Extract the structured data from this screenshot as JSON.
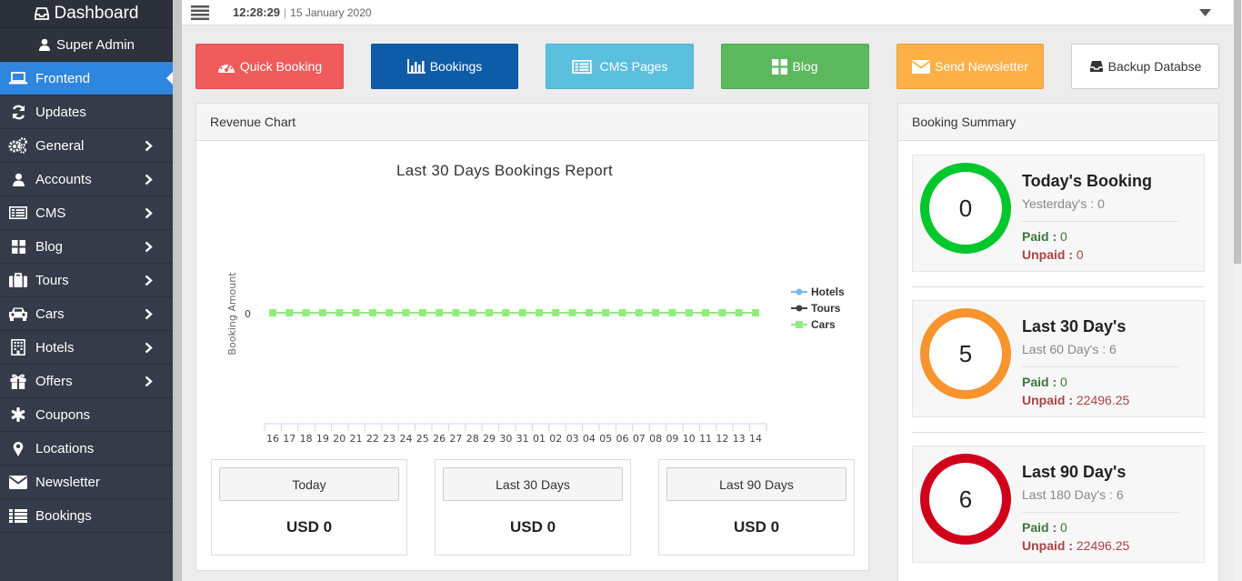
{
  "sidebar": {
    "brand": "Dashboard",
    "user": "Super Admin",
    "items": [
      {
        "label": "Frontend",
        "icon": "laptop-icon",
        "active": true
      },
      {
        "label": "Updates",
        "icon": "refresh-icon"
      },
      {
        "label": "General",
        "icon": "gears-icon",
        "submenu": true
      },
      {
        "label": "Accounts",
        "icon": "user-icon",
        "submenu": true
      },
      {
        "label": "CMS",
        "icon": "list-icon",
        "submenu": true
      },
      {
        "label": "Blog",
        "icon": "grid-icon",
        "submenu": true
      },
      {
        "label": "Tours",
        "icon": "suitcase-icon",
        "submenu": true
      },
      {
        "label": "Cars",
        "icon": "car-icon",
        "submenu": true
      },
      {
        "label": "Hotels",
        "icon": "building-icon",
        "submenu": true
      },
      {
        "label": "Offers",
        "icon": "gift-icon",
        "submenu": true
      },
      {
        "label": "Coupons",
        "icon": "asterisk-icon"
      },
      {
        "label": "Locations",
        "icon": "map-marker-icon"
      },
      {
        "label": "Newsletter",
        "icon": "envelope-icon"
      },
      {
        "label": "Bookings",
        "icon": "list-icon"
      }
    ]
  },
  "topbar": {
    "time": "12:28:29",
    "separator": "|",
    "date": "15 January 2020"
  },
  "quick_buttons": {
    "quick_booking": "Quick Booking",
    "bookings": "Bookings",
    "cms_pages": "CMS Pages",
    "blog": "Blog",
    "send_newsletter": "Send Newsletter",
    "backup": "Backup Databse"
  },
  "colors": {
    "quick_booking": "#ef5b5b",
    "bookings": "#0e5ca8",
    "cms_pages": "#5bc0de",
    "blog": "#5cb85c",
    "send_newsletter": "#fdb046",
    "sidebar_active": "#2e86de"
  },
  "revenue": {
    "title": "Revenue Chart",
    "stats": [
      {
        "label": "Today",
        "value": "USD 0"
      },
      {
        "label": "Last 30 Days",
        "value": "USD 0"
      },
      {
        "label": "Last 90 Days",
        "value": "USD 0"
      }
    ]
  },
  "chart_data": {
    "type": "line",
    "title": "Last 30 Days Bookings Report",
    "xlabel": "",
    "ylabel": "Booking Amount",
    "categories": [
      "16",
      "17",
      "18",
      "19",
      "20",
      "21",
      "22",
      "23",
      "24",
      "25",
      "26",
      "27",
      "28",
      "29",
      "30",
      "31",
      "01",
      "02",
      "03",
      "04",
      "05",
      "06",
      "07",
      "08",
      "09",
      "10",
      "11",
      "12",
      "13",
      "14"
    ],
    "y_ticks": [
      "0"
    ],
    "legend_position": "right",
    "series": [
      {
        "name": "Hotels",
        "color": "#7cb5ec",
        "values": [
          0,
          0,
          0,
          0,
          0,
          0,
          0,
          0,
          0,
          0,
          0,
          0,
          0,
          0,
          0,
          0,
          0,
          0,
          0,
          0,
          0,
          0,
          0,
          0,
          0,
          0,
          0,
          0,
          0,
          0
        ]
      },
      {
        "name": "Tours",
        "color": "#434348",
        "values": [
          0,
          0,
          0,
          0,
          0,
          0,
          0,
          0,
          0,
          0,
          0,
          0,
          0,
          0,
          0,
          0,
          0,
          0,
          0,
          0,
          0,
          0,
          0,
          0,
          0,
          0,
          0,
          0,
          0,
          0
        ]
      },
      {
        "name": "Cars",
        "color": "#90ed7d",
        "values": [
          0,
          0,
          0,
          0,
          0,
          0,
          0,
          0,
          0,
          0,
          0,
          0,
          0,
          0,
          0,
          0,
          0,
          0,
          0,
          0,
          0,
          0,
          0,
          0,
          0,
          0,
          0,
          0,
          0,
          0
        ]
      }
    ]
  },
  "summary": {
    "title": "Booking Summary",
    "cards": [
      {
        "title": "Today's Booking",
        "count": "0",
        "sub": "Yesterday's : 0",
        "paid_label": "Paid :",
        "paid": "0",
        "unpaid_label": "Unpaid :",
        "unpaid": "0",
        "color": "#00c72c"
      },
      {
        "title": "Last 30 Day's",
        "count": "5",
        "sub": "Last 60 Day's : 6",
        "paid_label": "Paid :",
        "paid": "0",
        "unpaid_label": "Unpaid :",
        "unpaid": "22496.25",
        "color": "#f7942e"
      },
      {
        "title": "Last 90 Day's",
        "count": "6",
        "sub": "Last 180 Day's : 6",
        "paid_label": "Paid :",
        "paid": "0",
        "unpaid_label": "Unpaid :",
        "unpaid": "22496.25",
        "color": "#d0021b"
      }
    ]
  }
}
